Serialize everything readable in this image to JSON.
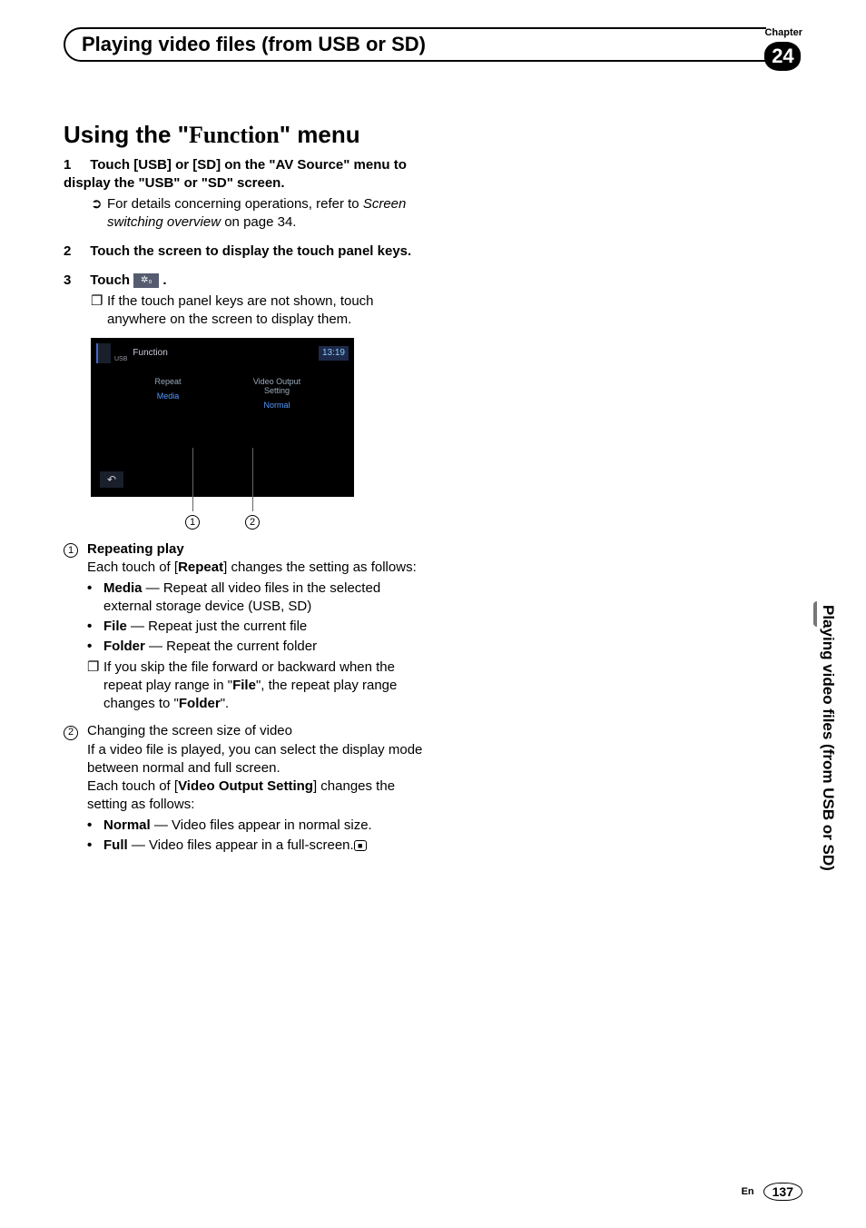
{
  "header": {
    "chapter_label": "Chapter",
    "chapter_number": "24",
    "title": "Playing video files (from USB or SD)"
  },
  "section_title_prefix": "Using the \"",
  "section_title_mid": "Function",
  "section_title_suffix": "\" menu",
  "steps": {
    "s1": {
      "num": "1",
      "text": "Touch [USB] or [SD] on the \"AV Source\" menu to display the \"USB\" or \"SD\" screen."
    },
    "s1_sub_bullet": "➲",
    "s1_sub_a": "For details concerning operations, refer to ",
    "s1_sub_b": "Screen switching overview",
    "s1_sub_c": " on page 34.",
    "s2": {
      "num": "2",
      "text": "Touch the screen to display the touch panel keys."
    },
    "s3": {
      "num": "3",
      "text_a": "Touch ",
      "text_b": "."
    },
    "s3_icon": "✲₀",
    "s3_sub_bullet": "❐",
    "s3_sub": "If the touch panel keys are not shown, touch anywhere on the screen to display them."
  },
  "screenshot": {
    "usb": "USB",
    "function": "Function",
    "time": "13:19",
    "col1_top": "Repeat",
    "col1_val": "Media",
    "col2_top": "Video Output Setting",
    "col2_val": "Normal",
    "back": "↶",
    "callout1": "1",
    "callout2": "2"
  },
  "defs": {
    "d1_num": "1",
    "d1_title": "Repeating play",
    "d1_a": "Each touch of [",
    "d1_b": "Repeat",
    "d1_c": "] changes the setting as follows:",
    "d1_media_a": "Media",
    "d1_media_b": " — Repeat all video files in the selected external storage device (USB, SD)",
    "d1_file_a": "File",
    "d1_file_b": " — Repeat just the current file",
    "d1_folder_a": "Folder",
    "d1_folder_b": " — Repeat the current folder",
    "d1_note_icon": "❐",
    "d1_note_a": "If you skip the file forward or backward when the repeat play range in \"",
    "d1_note_b": "File",
    "d1_note_c": "\", the repeat play range changes to \"",
    "d1_note_d": "Folder",
    "d1_note_e": "\".",
    "d2_num": "2",
    "d2_line1": "Changing the screen size of video",
    "d2_line2": "If a video file is played, you can select the display mode between normal and full screen.",
    "d2_a": "Each touch of [",
    "d2_b": "Video Output Setting",
    "d2_c": "] changes the setting as follows:",
    "d2_normal_a": "Normal",
    "d2_normal_b": " — Video files appear in normal size.",
    "d2_full_a": "Full",
    "d2_full_b": " — Video files appear in a full-screen.",
    "end_mark": "■"
  },
  "sidebar_text": "Playing video files (from USB or SD)",
  "footer": {
    "lang": "En",
    "page": "137"
  }
}
